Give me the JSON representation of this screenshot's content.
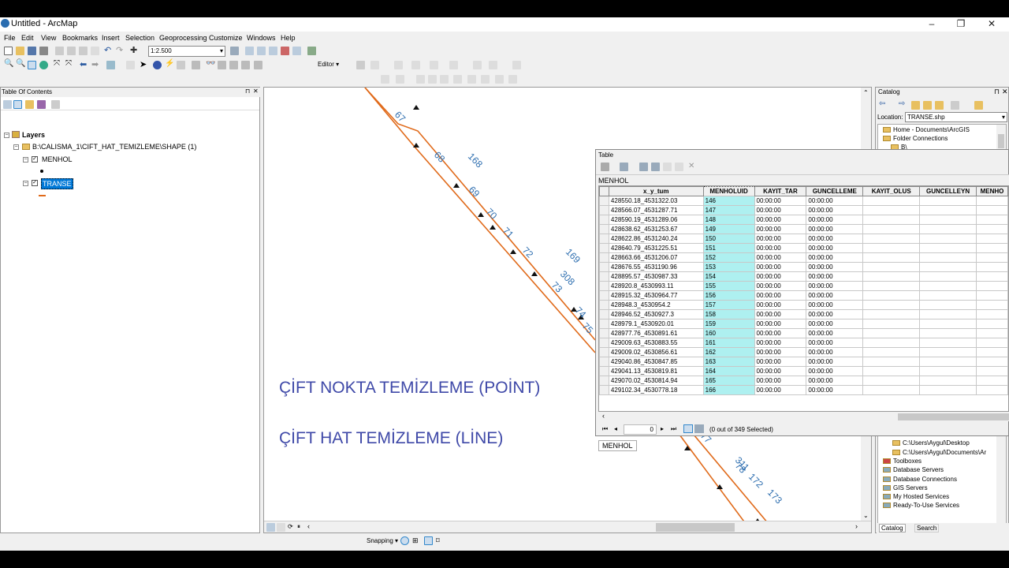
{
  "window": {
    "title": "Untitled - ArcMap"
  },
  "menu": [
    "File",
    "Edit",
    "View",
    "Bookmarks",
    "Insert",
    "Selection",
    "Geoprocessing",
    "Customize",
    "Windows",
    "Help"
  ],
  "toolbar": {
    "scale": "1:2.500",
    "editor": "Editor"
  },
  "toc": {
    "title": "Table Of Contents",
    "root": "Layers",
    "path": "B:\\CALISMA_1\\CIFT_HAT_TEMIZLEME\\SHAPE (1)",
    "layers": [
      "MENHOL",
      "TRANSE"
    ]
  },
  "map": {
    "overlay1": "ÇİFT NOKTA TEMİZLEME (POİNT)",
    "overlay2": "ÇİFT HAT TEMİZLEME (LİNE)",
    "labels": [
      "67",
      "68",
      "69",
      "70",
      "71",
      "72",
      "73",
      "74",
      "75",
      "168",
      "169",
      "308",
      "77",
      "78",
      "311",
      "172",
      "173"
    ]
  },
  "catalog": {
    "title": "Catalog",
    "location_label": "Location:",
    "location": "TRANSE.shp",
    "items_top": [
      "Home - Documents\\ArcGIS",
      "Folder Connections",
      "B\\"
    ],
    "items_bottom": [
      "C:\\Users\\Aygul\\Desktop",
      "C:\\Users\\Aygul\\Documents\\Ar",
      "Toolboxes",
      "Database Servers",
      "Database Connections",
      "GIS Servers",
      "My Hosted Services",
      "Ready-To-Use Services"
    ],
    "tabs": [
      "Catalog",
      "Search"
    ]
  },
  "table": {
    "title": "Table",
    "layer": "MENHOL",
    "tab": "MENHOL",
    "record": "0",
    "selected": "(0 out of 349 Selected)",
    "columns": [
      "x_y_tum",
      "MENHOLUID",
      "KAYIT_TAR",
      "GUNCELLEME",
      "KAYIT_OLUS",
      "GUNCELLEYN",
      "MENHO"
    ],
    "rows": [
      [
        "428550.18_4531322.03",
        "146"
      ],
      [
        "428566.07_4531287.71",
        "147"
      ],
      [
        "428590.19_4531289.06",
        "148"
      ],
      [
        "428638.62_4531253.67",
        "149"
      ],
      [
        "428622.86_4531240.24",
        "150"
      ],
      [
        "428640.79_4531225.51",
        "151"
      ],
      [
        "428663.66_4531206.07",
        "152"
      ],
      [
        "428676.55_4531190.96",
        "153"
      ],
      [
        "428895.57_4530987.33",
        "154"
      ],
      [
        "428920.8_4530993.11",
        "155"
      ],
      [
        "428915.32_4530964.77",
        "156"
      ],
      [
        "428948.3_4530954.2",
        "157"
      ],
      [
        "428946.52_4530927.3",
        "158"
      ],
      [
        "428979.1_4530920.01",
        "159"
      ],
      [
        "428977.76_4530891.61",
        "160"
      ],
      [
        "429009.63_4530883.55",
        "161"
      ],
      [
        "429009.02_4530856.61",
        "162"
      ],
      [
        "429040.86_4530847.85",
        "163"
      ],
      [
        "429041.13_4530819.81",
        "164"
      ],
      [
        "429070.02_4530814.94",
        "165"
      ],
      [
        "429102.34_4530778.18",
        "166"
      ]
    ],
    "time": "00:00:00"
  },
  "status": {
    "snapping": "Snapping"
  },
  "colors": {
    "line": "#e06a1a",
    "label": "#2f6fb0",
    "overlay": "#3f49a8",
    "select": "#0078d7"
  }
}
